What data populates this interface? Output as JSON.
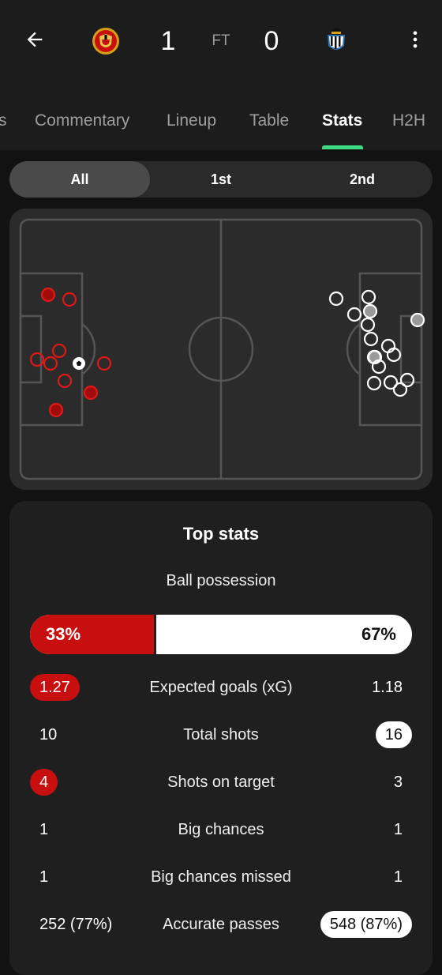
{
  "match": {
    "home_score": "1",
    "away_score": "0",
    "status": "FT"
  },
  "tabs": [
    {
      "label": "s"
    },
    {
      "label": "Commentary"
    },
    {
      "label": "Lineup"
    },
    {
      "label": "Table"
    },
    {
      "label": "Stats"
    },
    {
      "label": "H2H"
    }
  ],
  "active_tab": "Stats",
  "periods": [
    {
      "label": "All"
    },
    {
      "label": "1st"
    },
    {
      "label": "2nd"
    }
  ],
  "active_period": "All",
  "colors": {
    "home": "#c80f0f",
    "away": "#ffffff",
    "accent": "#3ddc84"
  },
  "shot_map": {
    "home_shots": [
      {
        "type": "on_target"
      },
      {
        "type": "off_target"
      },
      {
        "type": "off_target"
      },
      {
        "type": "off_target"
      },
      {
        "type": "off_target"
      },
      {
        "type": "off_target"
      },
      {
        "type": "off_target"
      },
      {
        "type": "on_target"
      },
      {
        "type": "on_target"
      },
      {
        "type": "goal"
      }
    ],
    "away_shots": [
      {
        "type": "off_target"
      },
      {
        "type": "off_target"
      },
      {
        "type": "off_target"
      },
      {
        "type": "on_target"
      },
      {
        "type": "off_target"
      },
      {
        "type": "on_target"
      },
      {
        "type": "off_target"
      },
      {
        "type": "off_target"
      },
      {
        "type": "off_target"
      },
      {
        "type": "on_target"
      },
      {
        "type": "off_target"
      },
      {
        "type": "off_target"
      },
      {
        "type": "off_target"
      },
      {
        "type": "off_target"
      },
      {
        "type": "off_target"
      },
      {
        "type": "off_target"
      }
    ]
  },
  "top_stats": {
    "title": "Top stats",
    "possession": {
      "label": "Ball possession",
      "home": "33%",
      "away": "67%",
      "home_value": 33
    },
    "rows": [
      {
        "label": "Expected goals (xG)",
        "home": "1.27",
        "away": "1.18",
        "highlight": "home"
      },
      {
        "label": "Total shots",
        "home": "10",
        "away": "16",
        "highlight": "away"
      },
      {
        "label": "Shots on target",
        "home": "4",
        "away": "3",
        "highlight": "home"
      },
      {
        "label": "Big chances",
        "home": "1",
        "away": "1",
        "highlight": "none"
      },
      {
        "label": "Big chances missed",
        "home": "1",
        "away": "1",
        "highlight": "none"
      },
      {
        "label": "Accurate passes",
        "home": "252 (77%)",
        "away": "548 (87%)",
        "highlight": "away"
      }
    ]
  },
  "icons": {
    "back": "arrow-left-icon",
    "more": "more-vertical-icon",
    "home_crest": "manchester-united-crest",
    "away_crest": "newcastle-united-crest",
    "goal_marker": "football-icon"
  }
}
